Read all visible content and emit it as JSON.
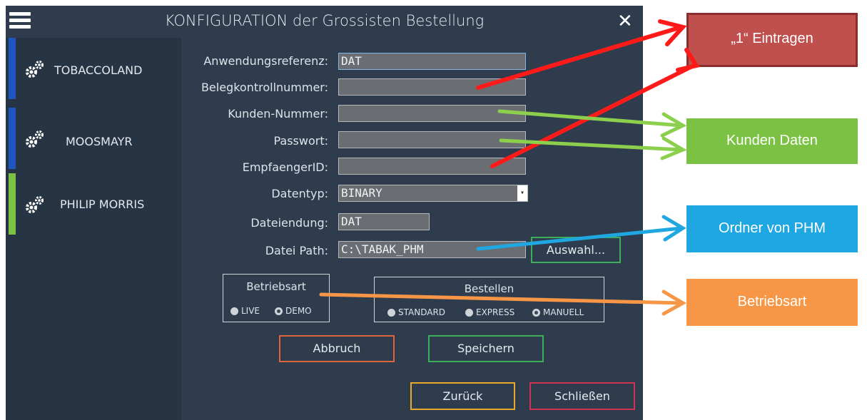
{
  "window": {
    "title": "KONFIGURATION der Grossisten Bestellung",
    "close_glyph": "✕"
  },
  "sidebar": {
    "items": [
      {
        "label": "TOBACCOLAND",
        "accent": "#1e55c0"
      },
      {
        "label": "MOOSMAYR",
        "accent": "#1e55c0"
      },
      {
        "label": "PHILIP MORRIS",
        "accent": "#7bc143"
      }
    ]
  },
  "form": {
    "fields": [
      {
        "label": "Anwendungsreferenz:",
        "value": "DAT"
      },
      {
        "label": "Belegkontrollnummer:",
        "value": ""
      },
      {
        "label": "Kunden-Nummer:",
        "value": ""
      },
      {
        "label": "Passwort:",
        "value": ""
      },
      {
        "label": "EmpfaengerID:",
        "value": ""
      }
    ],
    "datentyp": {
      "label": "Datentyp:",
      "value": "BINARY"
    },
    "dateiendung": {
      "label": "Dateiendung:",
      "value": "DAT"
    },
    "datei_path": {
      "label": "Datei Path:",
      "value": "C:\\TABAK_PHM",
      "button": "Auswahl..."
    }
  },
  "betriebsart": {
    "title": "Betriebsart",
    "options": [
      {
        "label": "LIVE",
        "selected": false
      },
      {
        "label": "DEMO",
        "selected": true
      }
    ]
  },
  "bestellen": {
    "title": "Bestellen",
    "options": [
      {
        "label": "STANDARD",
        "selected": false
      },
      {
        "label": "EXPRESS",
        "selected": false
      },
      {
        "label": "MANUELL",
        "selected": true
      }
    ]
  },
  "buttons": {
    "abbruch": "Abbruch",
    "speichern": "Speichern",
    "zurueck": "Zurück",
    "schliessen": "Schließen"
  },
  "callouts": {
    "eintragen": {
      "label": "„1“ Eintragen",
      "color": "#c0504d"
    },
    "kunden_daten": {
      "label": "Kunden Daten",
      "color": "#7bc143"
    },
    "ordner": {
      "label": "Ordner von PHM",
      "color": "#1ea7e1"
    },
    "betriebsart": {
      "label": "Betriebsart",
      "color": "#f79646"
    }
  },
  "colors": {
    "panel": "#2e3c4d",
    "sidebar": "#273444",
    "field": "#6a6e72",
    "arrow_red": "#ff1a1a",
    "arrow_green": "#8ccf4d",
    "arrow_blue": "#1ea7e1",
    "arrow_orange": "#f79646"
  }
}
